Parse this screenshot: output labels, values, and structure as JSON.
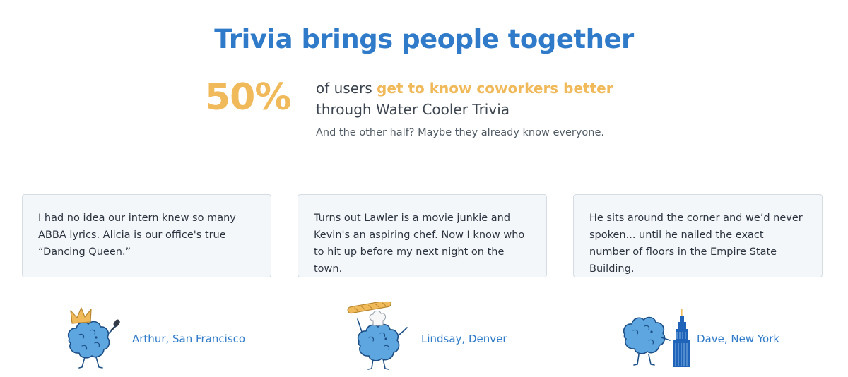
{
  "section": {
    "title": "Trivia brings people together"
  },
  "stat": {
    "percent": "50%",
    "line1_prefix": "of users ",
    "line1_highlight": "get to know coworkers better",
    "line2": "through Water Cooler Trivia",
    "subtext": "And the other half? Maybe they already know everyone."
  },
  "testimonials": [
    {
      "quote": "I had no idea our intern knew so many ABBA lyrics. Alicia is our office's true “Dancing Queen.”",
      "author": "Arthur, San Francisco",
      "mascot_icon": "brain-mascot-crown-microphone-icon"
    },
    {
      "quote": "Turns out Lawler is a movie junkie and Kevin's an aspiring chef. Now I know who to hit up before my next night on the town.",
      "author": "Lindsay, Denver",
      "mascot_icon": "brain-mascot-chef-baguette-icon"
    },
    {
      "quote": "He sits around the corner and we’d never spoken... until he nailed the exact number of floors in the Empire State Building.",
      "author": "Dave, New York",
      "mascot_icon": "brain-mascot-empire-state-building-icon"
    }
  ],
  "colors": {
    "title_blue": "#2f7bc9",
    "accent_yellow": "#f0b95a",
    "mascot_blue": "#5ea6e0",
    "card_background": "#f4f7fa"
  }
}
